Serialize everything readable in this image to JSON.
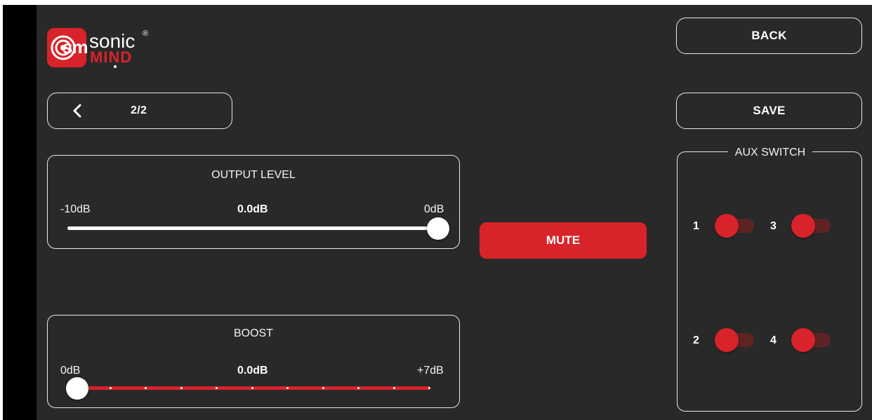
{
  "logo": {
    "monogram": "sm",
    "word_top": "sonic",
    "word_bottom": "MIND",
    "registered": "®"
  },
  "nav": {
    "back_label": "BACK",
    "save_label": "SAVE",
    "page_indicator": "2/2"
  },
  "output_level": {
    "title": "OUTPUT LEVEL",
    "min_label": "-10dB",
    "max_label": "0dB",
    "value_label": "0.0dB",
    "value_fraction": 1.0
  },
  "boost": {
    "title": "BOOST",
    "min_label": "0dB",
    "max_label": "+7dB",
    "value_label": "0.0dB",
    "value_fraction": 0.0
  },
  "mute": {
    "label": "MUTE"
  },
  "aux_switch": {
    "title": "AUX SWITCH",
    "switches": [
      {
        "label": "1",
        "on": false
      },
      {
        "label": "3",
        "on": false
      },
      {
        "label": "2",
        "on": false
      },
      {
        "label": "4",
        "on": false
      }
    ]
  },
  "colors": {
    "background": "#2a2929",
    "accent_red": "#d8232a",
    "outline": "#e9e9e9"
  }
}
